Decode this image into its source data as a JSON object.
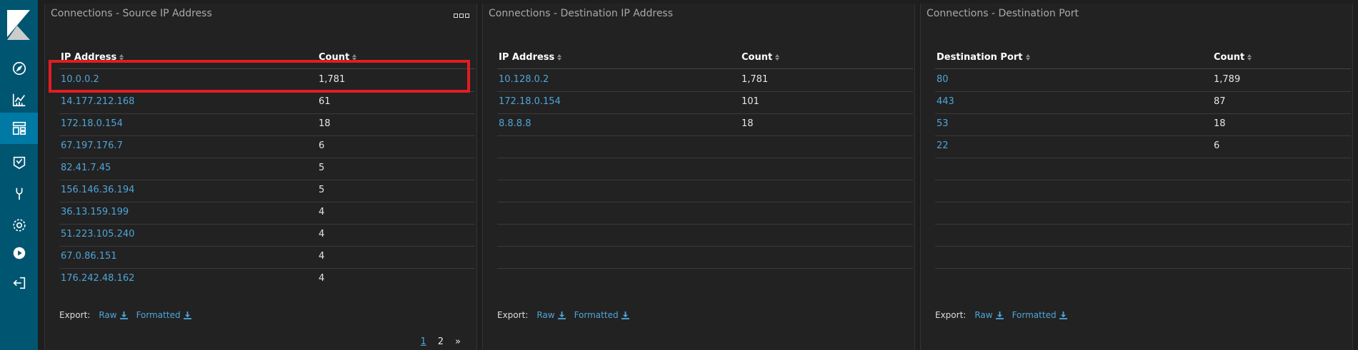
{
  "panels": [
    {
      "title": "Connections - Source IP Address",
      "columns": [
        "IP Address",
        "Count"
      ],
      "rows": [
        {
          "key": "10.0.0.2",
          "count": "1,781"
        },
        {
          "key": "14.177.212.168",
          "count": "61"
        },
        {
          "key": "172.18.0.154",
          "count": "18"
        },
        {
          "key": "67.197.176.7",
          "count": "6"
        },
        {
          "key": "82.41.7.45",
          "count": "5"
        },
        {
          "key": "156.146.36.194",
          "count": "5"
        },
        {
          "key": "36.13.159.199",
          "count": "4"
        },
        {
          "key": "51.223.105.240",
          "count": "4"
        },
        {
          "key": "67.0.86.151",
          "count": "4"
        },
        {
          "key": "176.242.48.162",
          "count": "4"
        }
      ],
      "export": {
        "label": "Export:",
        "raw": "Raw",
        "formatted": "Formatted"
      },
      "pagination": {
        "pages": [
          "1",
          "2"
        ],
        "current": "1",
        "next": "»"
      }
    },
    {
      "title": "Connections - Destination IP Address",
      "columns": [
        "IP Address",
        "Count"
      ],
      "rows": [
        {
          "key": "10.128.0.2",
          "count": "1,781"
        },
        {
          "key": "172.18.0.154",
          "count": "101"
        },
        {
          "key": "8.8.8.8",
          "count": "18"
        }
      ],
      "export": {
        "label": "Export:",
        "raw": "Raw",
        "formatted": "Formatted"
      }
    },
    {
      "title": "Connections - Destination Port",
      "columns": [
        "Destination Port",
        "Count"
      ],
      "rows": [
        {
          "key": "80",
          "count": "1,789"
        },
        {
          "key": "443",
          "count": "87"
        },
        {
          "key": "53",
          "count": "18"
        },
        {
          "key": "22",
          "count": "6"
        }
      ],
      "export": {
        "label": "Export:",
        "raw": "Raw",
        "formatted": "Formatted"
      }
    }
  ],
  "sidebar": {
    "items": [
      "kibana-logo",
      "discover-icon",
      "visualize-icon",
      "dashboard-icon",
      "timelion-icon",
      "dev-tools-icon",
      "management-icon",
      "play-icon",
      "logout-icon"
    ],
    "active": "dashboard-icon"
  },
  "colors": {
    "sidebar": "#005571",
    "active": "#0079a5",
    "link": "#4ea5d9",
    "highlight": "#e11d22"
  }
}
